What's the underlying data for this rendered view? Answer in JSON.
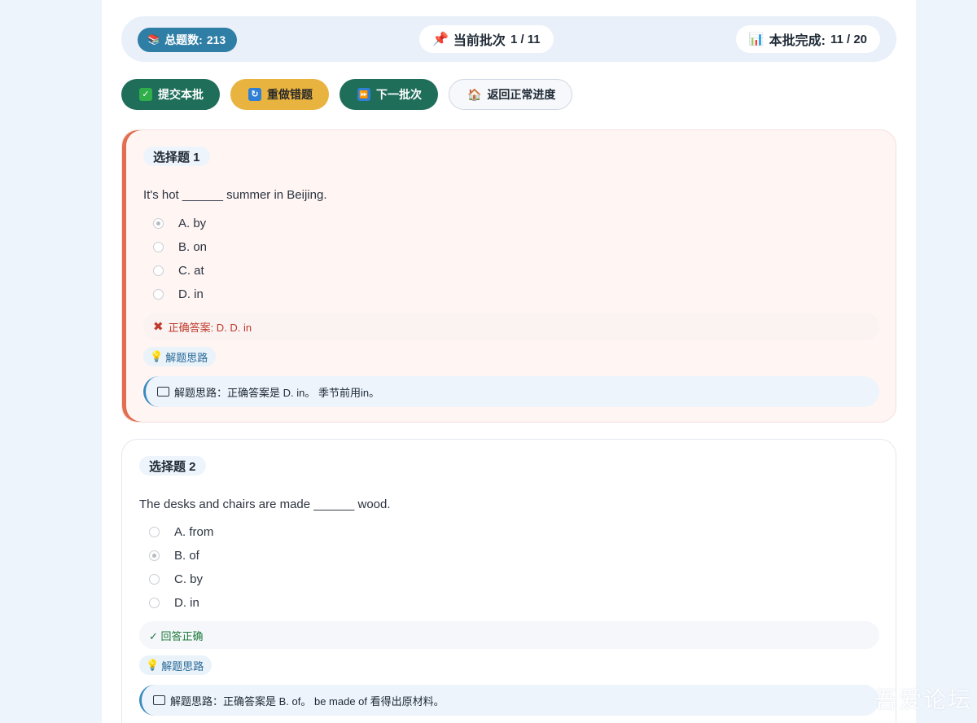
{
  "status": {
    "total_label": "总题数:",
    "total_value": "213",
    "batch_label": "当前批次",
    "batch_value": "1 / 11",
    "done_label": "本批完成:",
    "done_value": "11 / 20"
  },
  "actions": {
    "submit": "提交本批",
    "redo": "重做错题",
    "next": "下一批次",
    "back": "返回正常进度"
  },
  "questions": [
    {
      "tag": "选择题 1",
      "text": "It's hot ______ summer in Beijing.",
      "options": [
        "A. by",
        "B. on",
        "C. at",
        "D. in"
      ],
      "selected": 0,
      "result": "正确答案: D. D. in",
      "result_status": "wrong",
      "hint_label": "解题思路",
      "explanation": "解题思路：正确答案是 D. in。 季节前用in。"
    },
    {
      "tag": "选择题 2",
      "text": "The desks and chairs are made ______ wood.",
      "options": [
        "A. from",
        "B. of",
        "C. by",
        "D. in"
      ],
      "selected": 1,
      "result": "✓ 回答正确",
      "result_status": "correct",
      "hint_label": "解题思路",
      "explanation": "解题思路：正确答案是 B. of。 be made of 看得出原材料。"
    }
  ],
  "watermark": "吾爱论坛",
  "colors": {
    "accent_green": "#1f6e5a",
    "accent_yellow": "#e8b33e",
    "wrong_bar": "#e26d4f",
    "total_pill": "#2e7ea6"
  }
}
